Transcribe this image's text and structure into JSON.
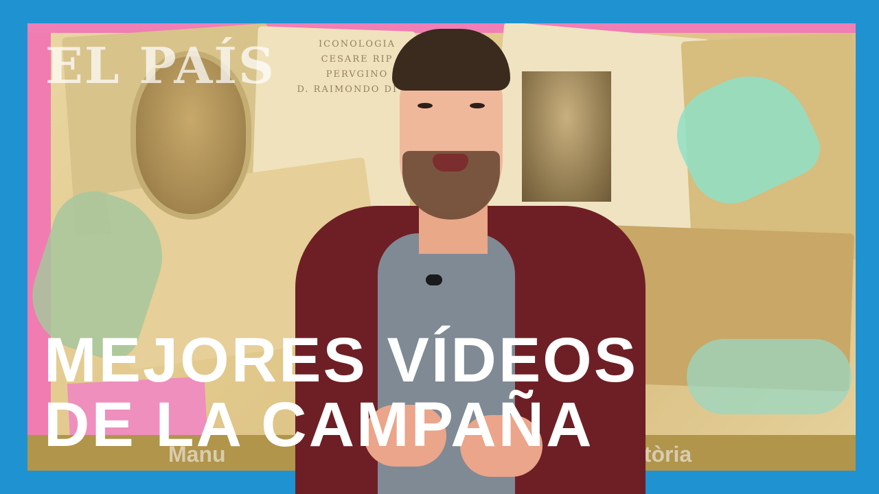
{
  "brand": {
    "logo_text": "EL PAÍS"
  },
  "headline": {
    "line1": "MEJORES VÍDEOS",
    "line2": "DE LA CAMPAÑA"
  },
  "background": {
    "book_cover_text": [
      "ICONOLOGIA",
      "CESARE RIP",
      "PERVGINO",
      "D. RAIMONDO DI SA"
    ],
    "lower_third_left": "Manu",
    "lower_third_right": "stòria"
  },
  "colors": {
    "frame": "#1f93d2",
    "headline": "#ffffff",
    "accent_pink": "#f07cb2"
  }
}
